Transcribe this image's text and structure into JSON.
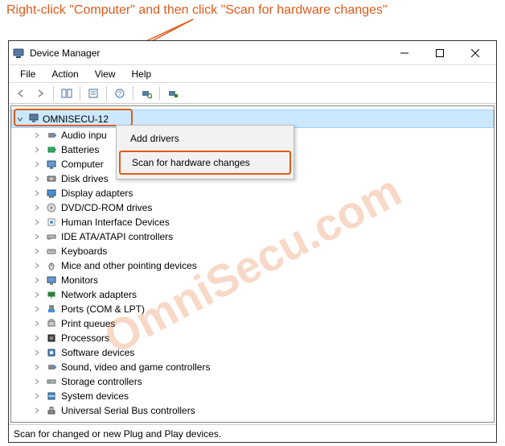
{
  "instruction": "Right-click \"Computer\" and then click \"Scan for hardware changes\"",
  "watermark": "OmniSecu.com",
  "window": {
    "title": "Device Manager"
  },
  "menubar": [
    "File",
    "Action",
    "View",
    "Help"
  ],
  "tree": {
    "root": "OMNISECU-12",
    "children": [
      "Audio inpu",
      "Batteries",
      "Computer",
      "Disk drives",
      "Display adapters",
      "DVD/CD-ROM drives",
      "Human Interface Devices",
      "IDE ATA/ATAPI controllers",
      "Keyboards",
      "Mice and other pointing devices",
      "Monitors",
      "Network adapters",
      "Ports (COM & LPT)",
      "Print queues",
      "Processors",
      "Software devices",
      "Sound, video and game controllers",
      "Storage controllers",
      "System devices",
      "Universal Serial Bus controllers"
    ]
  },
  "context_menu": {
    "items": [
      {
        "label": "Add drivers",
        "highlighted": false
      },
      {
        "label": "Scan for hardware changes",
        "highlighted": true
      }
    ]
  },
  "statusbar": "Scan for changed or new Plug and Play devices."
}
